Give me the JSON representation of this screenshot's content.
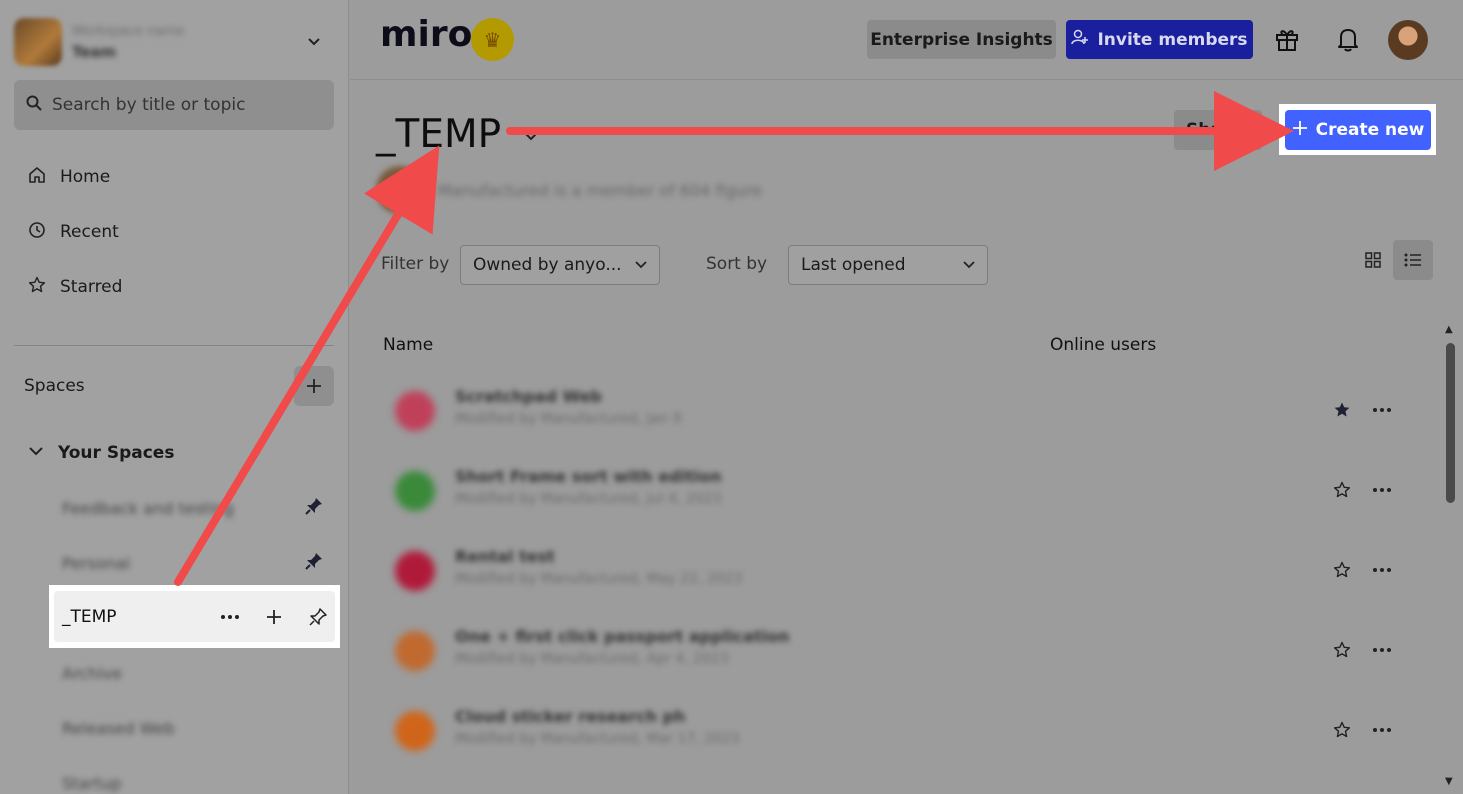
{
  "sidebar": {
    "workspace": {
      "line1": "Workspace name",
      "line2": "Team"
    },
    "search_placeholder": "Search by title or topic",
    "nav": [
      {
        "label": "Home",
        "icon": "home-icon"
      },
      {
        "label": "Recent",
        "icon": "clock-icon"
      },
      {
        "label": "Starred",
        "icon": "star-icon"
      }
    ],
    "spaces_label": "Spaces",
    "your_spaces_label": "Your Spaces",
    "space_items": [
      {
        "label": "Feedback and testing",
        "pinned": true
      },
      {
        "label": "Personal",
        "pinned": true
      },
      {
        "label": "_TEMP",
        "active": true
      },
      {
        "label": "Archive"
      },
      {
        "label": "Released Web"
      },
      {
        "label": "Startup"
      }
    ]
  },
  "header": {
    "logo": "miro",
    "crown_icon": "crown-icon",
    "enterprise_label": "Enterprise Insights",
    "invite_label": "Invite members",
    "accent_color": "#4262ff"
  },
  "main": {
    "title": "_TEMP",
    "owner_text": "Manufactured is a member of 604 figure",
    "share_label": "Share",
    "create_label": "Create new",
    "filter_label": "Filter by",
    "filter_value": "Owned by anyo...",
    "sort_label": "Sort by",
    "sort_value": "Last opened",
    "columns": {
      "name": "Name",
      "online": "Online users"
    },
    "boards": [
      {
        "title": "Scratchpad Web",
        "sub": "Modified by Manufactured, Jan 9",
        "color": "#c0405a",
        "starred": true
      },
      {
        "title": "Short Frame sort with edition",
        "sub": "Modified by Manufactured, Jul 4, 2023",
        "color": "#3a8a3a",
        "starred": false
      },
      {
        "title": "Rental test",
        "sub": "Modified by Manufactured, May 22, 2023",
        "color": "#b01a3a",
        "starred": false
      },
      {
        "title": "One + first click passport application",
        "sub": "Modified by Manufactured, Apr 4, 2023",
        "color": "#c06a30",
        "starred": false
      },
      {
        "title": "Cloud sticker research ph",
        "sub": "Modified by Manufactured, Mar 17, 2023",
        "color": "#d0651a",
        "starred": false
      }
    ]
  }
}
